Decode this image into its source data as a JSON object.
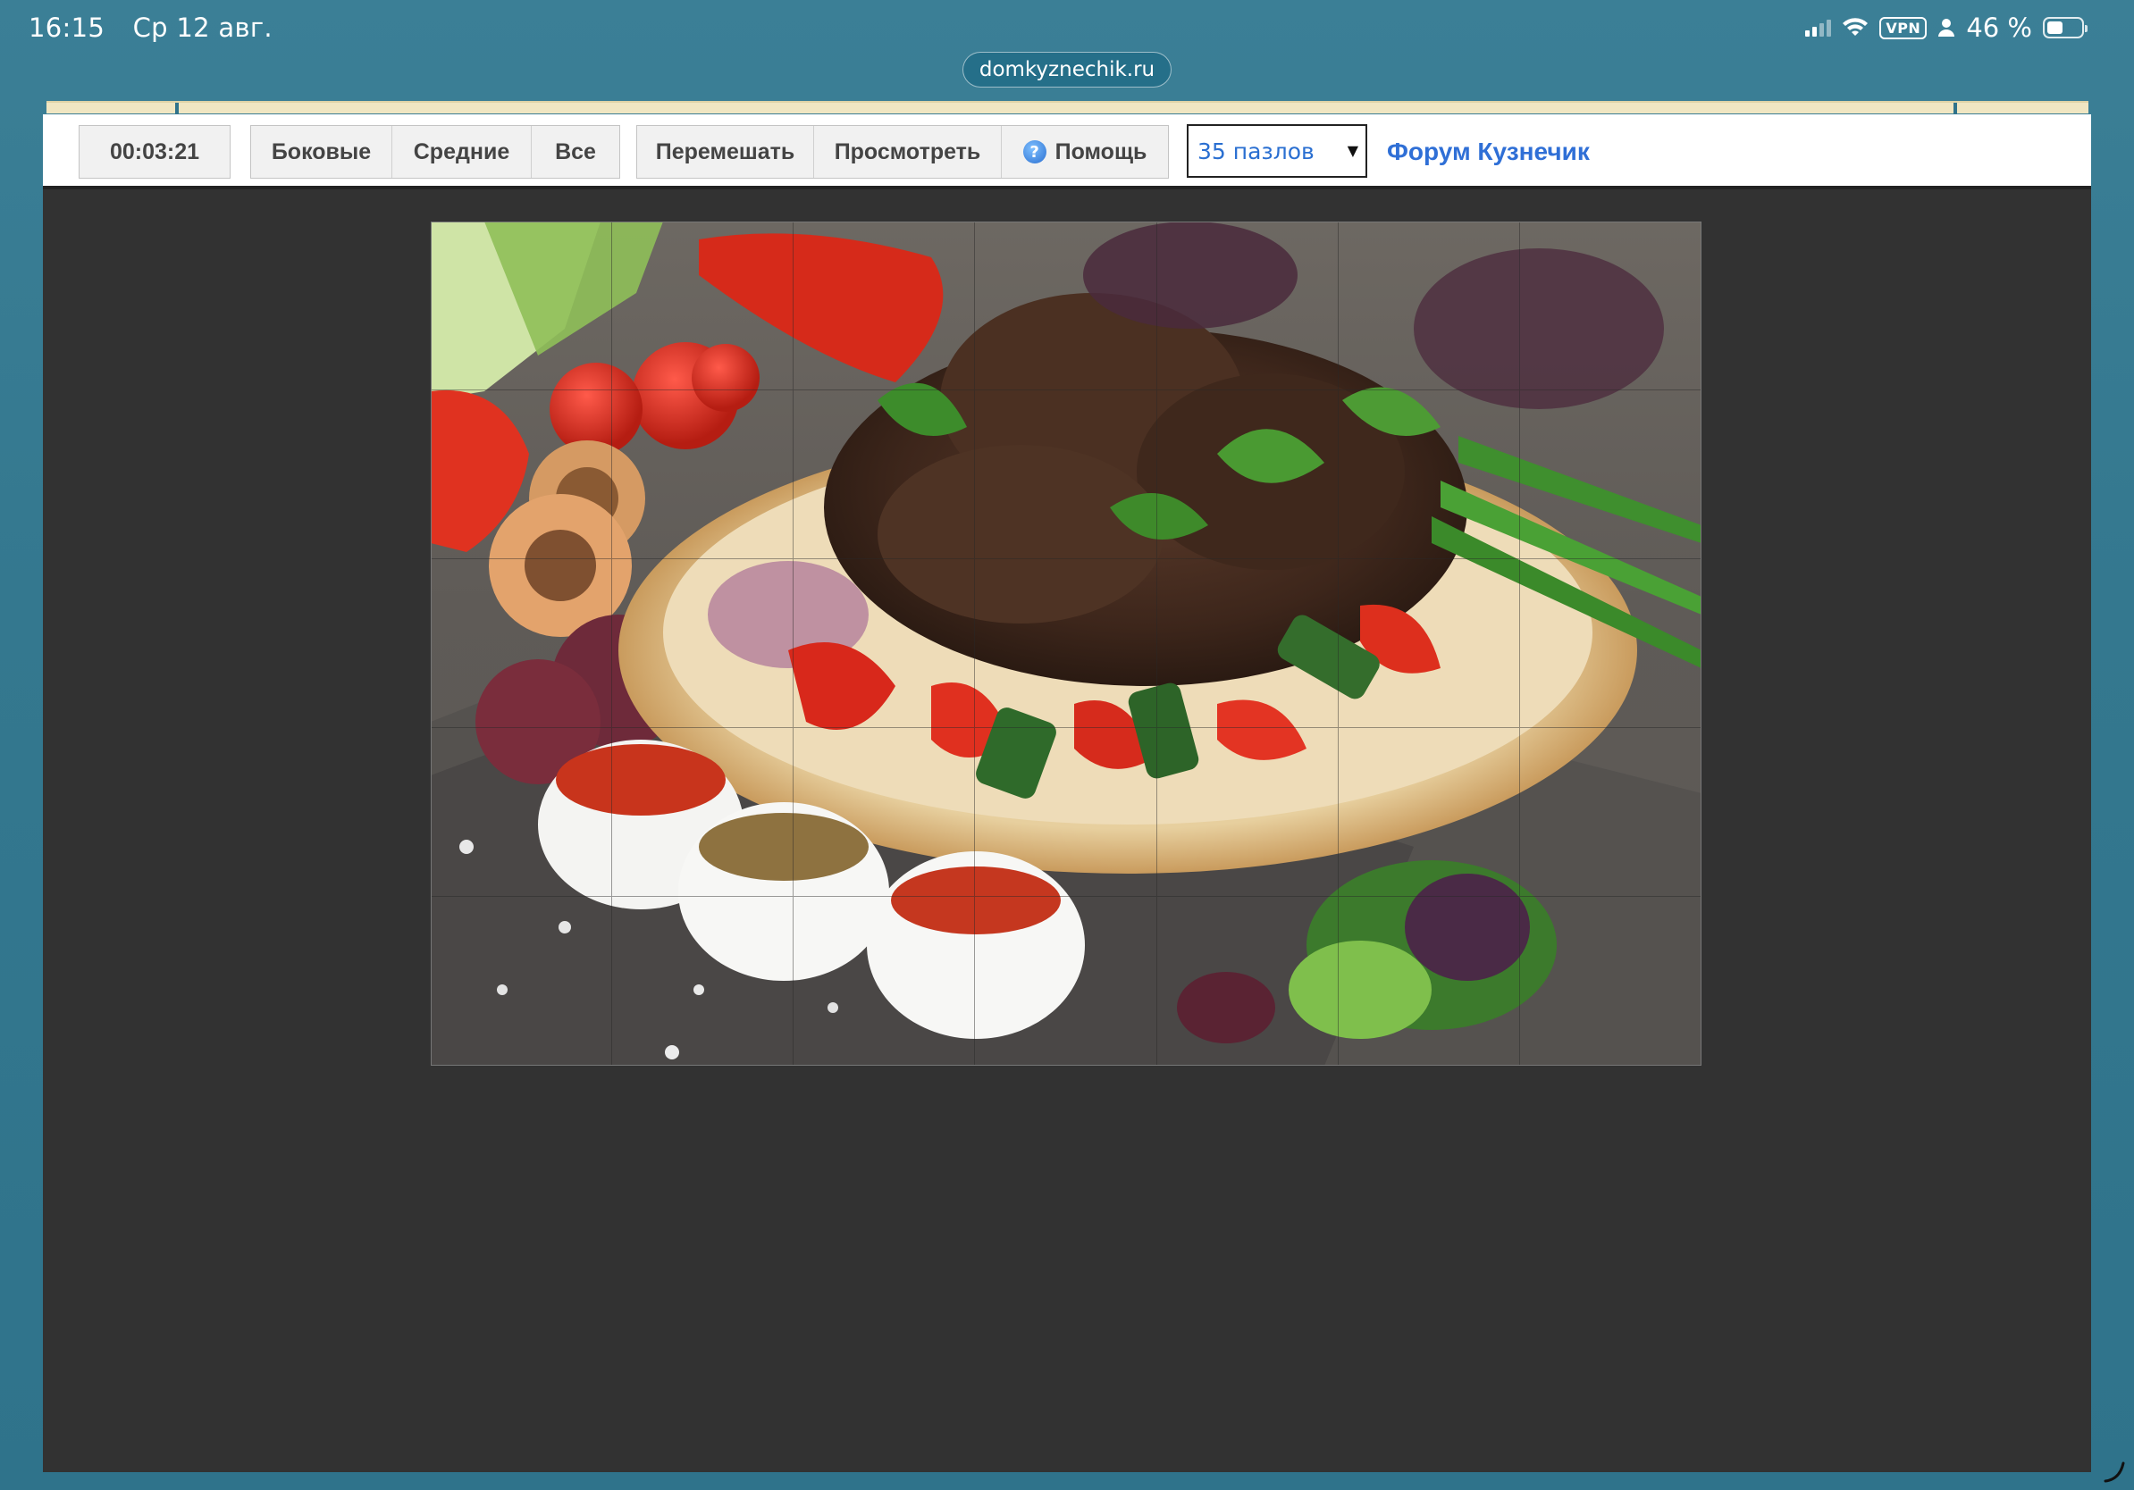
{
  "status_bar": {
    "time": "16:15",
    "date": "Ср 12 авг.",
    "vpn": "VPN",
    "battery": "46 %",
    "battery_level": 0.46
  },
  "browser": {
    "url": "domkyznechik.ru"
  },
  "toolbar": {
    "timer": "00:03:21",
    "filter_group": [
      "Боковые",
      "Средние",
      "Все"
    ],
    "action_group": {
      "shuffle": "Перемешать",
      "preview": "Просмотреть",
      "help": "Помощь",
      "help_icon": "?"
    },
    "pieces_select": "35 пазлов",
    "forum_link": "Форум Кузнечик"
  },
  "puzzle": {
    "rows": 5,
    "columns": 7,
    "subject": "food-platter-image"
  },
  "colors": {
    "background": "#34788f",
    "page": "#323232",
    "link": "#2f6fd6",
    "select_text": "#2a6fd1"
  }
}
